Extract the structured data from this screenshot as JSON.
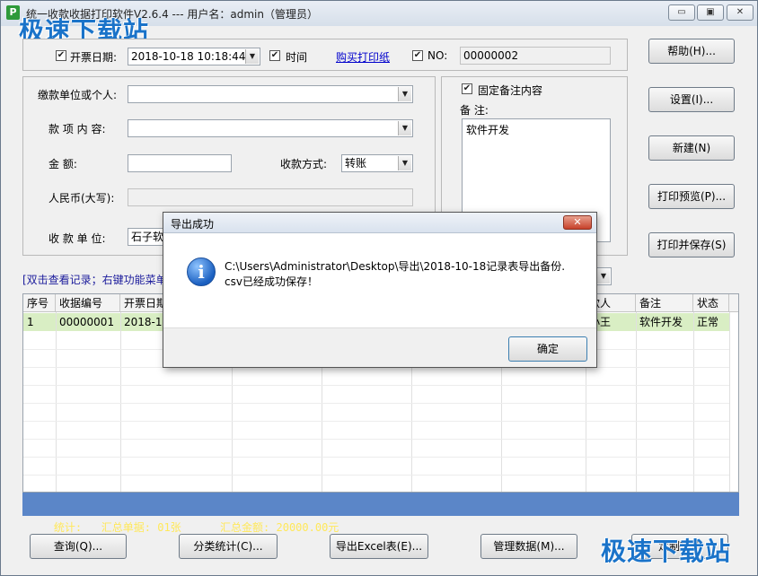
{
  "window": {
    "title": "统一收款收据打印软件V2.6.4 --- 用户名：admin（管理员）",
    "app_icon": "P",
    "min": "▭",
    "restore": "▣",
    "close": "✕"
  },
  "watermark": {
    "top_left": "极速下载站",
    "bottom_right": "极速下载站"
  },
  "top_bar": {
    "date_label": "开票日期:",
    "date_value": "2018-10-18 10:18:44",
    "time_label": "时间",
    "buy_link": "购买打印纸",
    "no_label": "NO:",
    "no_value": "00000002"
  },
  "form": {
    "payer_label": "缴款单位或个人:",
    "item_label": "款 项 内 容:",
    "amount_label": "金          额:",
    "method_label": "收款方式:",
    "method_value": "转账",
    "rmb_label": "人民币(大写):",
    "receiver_label": "收 款 单 位:",
    "receiver_value": "石子软"
  },
  "remark": {
    "fixed_label": "固定备注内容",
    "label": "备 注:",
    "value": "软件开发"
  },
  "side_buttons": {
    "help": "帮助(H)...",
    "settings": "设置(I)...",
    "new": "新建(N)",
    "preview": "打印预览(P)...",
    "print_save": "打印并保存(S)"
  },
  "hint": "[双击查看记录；右键功能菜单",
  "grid": {
    "headers_left": [
      "序号",
      "收据编号",
      "开票日期"
    ],
    "headers_right": [
      "款人",
      "备注",
      "状态"
    ],
    "row": {
      "seq": "1",
      "no": "00000001",
      "date": "2018-10",
      "person": "小王",
      "remark": "软件开发",
      "status": "正常"
    }
  },
  "status": {
    "text": "统计:   汇总单据: 01张      汇总金额: 20000.00元"
  },
  "bottom_buttons": {
    "query": "查询(Q)...",
    "classify": "分类统计(C)...",
    "export": "导出Excel表(E)...",
    "manage": "管理数据(M)...",
    "custom": "定制软件"
  },
  "dialog": {
    "title": "导出成功",
    "line1": "C:\\Users\\Administrator\\Desktop\\导出\\2018-10-18记录表导出备份.",
    "line2": "csv已经成功保存！",
    "ok": "确定"
  }
}
